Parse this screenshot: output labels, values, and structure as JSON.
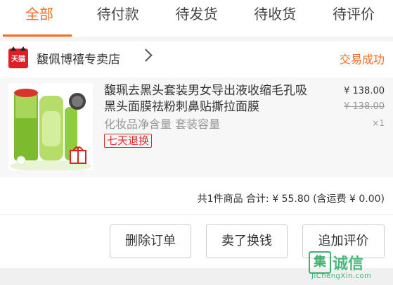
{
  "tabs": [
    {
      "label": "全部",
      "active": true
    },
    {
      "label": "待付款",
      "active": false
    },
    {
      "label": "待发货",
      "active": false
    },
    {
      "label": "待收货",
      "active": false
    },
    {
      "label": "待评价",
      "active": false
    }
  ],
  "shop": {
    "badge": "天猫",
    "name": "馥佩博禧专卖店",
    "status": "交易成功"
  },
  "product": {
    "title": "馥珮去黑头套装男女导出液收缩毛孔吸黑头面膜祛粉刺鼻贴撕拉面膜",
    "spec": "化妆品净含量 套装容量",
    "badge": "七天退换",
    "price": "¥ 138.00",
    "original_price": "¥ 138.00",
    "quantity": "×1"
  },
  "summary": {
    "text": "共1件商品  合计: ¥ 55.80 (含运费 ¥ 0.00)"
  },
  "actions": {
    "delete": "删除订单",
    "resell": "卖了换钱",
    "review": "追加评价"
  },
  "watermark": {
    "logo": "集",
    "text": "诚信",
    "url": "JiChengXin.com"
  },
  "colors": {
    "accent": "#f36c21",
    "tmall_red": "#e01e26",
    "badge_red": "#e02a2a",
    "watermark_green": "#3cb371"
  }
}
